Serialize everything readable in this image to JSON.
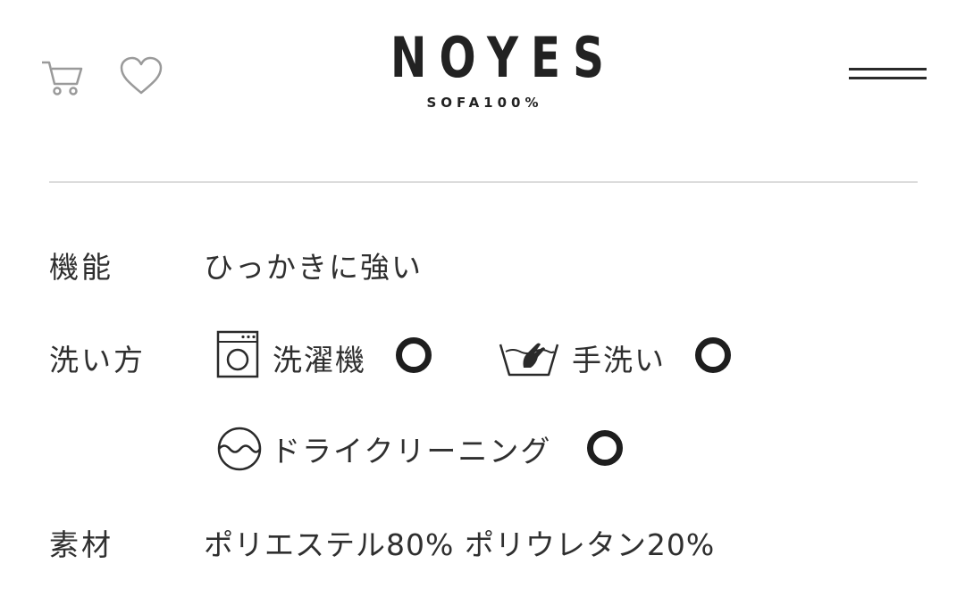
{
  "header": {
    "logo_main": "NOYES",
    "logo_sub": "SOFA100%",
    "icons": {
      "cart": "cart-icon",
      "favorite": "heart-icon",
      "menu": "hamburger-menu-icon"
    }
  },
  "specs": {
    "function": {
      "label": "機能",
      "value": "ひっかきに強い"
    },
    "washing": {
      "label": "洗い方",
      "methods": [
        {
          "icon": "washing-machine-icon",
          "label": "洗濯機",
          "status": "○"
        },
        {
          "icon": "hand-wash-icon",
          "label": "手洗い",
          "status": "○"
        },
        {
          "icon": "dry-clean-icon",
          "label": "ドライクリーニング",
          "status": "○"
        }
      ]
    },
    "material": {
      "label": "素材",
      "value": "ポリエステル80% ポリウレタン20%"
    }
  },
  "colors": {
    "text": "#2f2f2f",
    "icon_muted": "#9a9a9a",
    "divider": "#dcdcdc"
  }
}
